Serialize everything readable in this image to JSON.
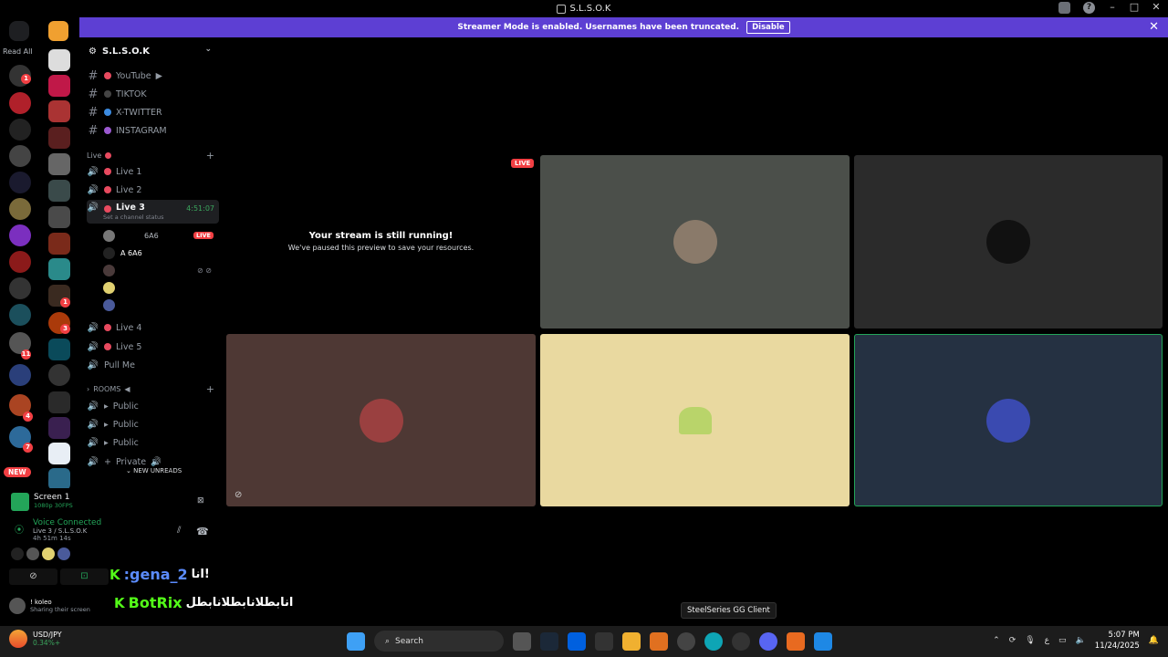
{
  "window": {
    "title": "S.L.S.O.K"
  },
  "banner": {
    "text": "Streamer Mode is enabled. Usernames have been truncated.",
    "disable_label": "Disable"
  },
  "rail": {
    "read_all": "Read All",
    "new_label": "NEW",
    "badges": [
      "1",
      "1",
      "3",
      "11",
      "4",
      "7"
    ]
  },
  "sidebar": {
    "server_name": "S.L.S.O.K",
    "text_channels": [
      {
        "label": "YouTube",
        "suffix": "▶",
        "color": "#e84a5f"
      },
      {
        "label": "TIKTOK",
        "suffix": "",
        "color": "#444"
      },
      {
        "label": "X-TWITTER",
        "suffix": "",
        "color": "#3c8be0"
      },
      {
        "label": "INSTAGRAM",
        "suffix": "",
        "color": "#9b59d0"
      }
    ],
    "live_category": "Live",
    "voice_channels_top": [
      {
        "label": "Live 1"
      },
      {
        "label": "Live 2"
      }
    ],
    "active_channel": {
      "label": "Live 3",
      "time": "4:51:07",
      "status": "Set a channel status"
    },
    "voice_users": [
      {
        "name": "6A6",
        "live": "LIVE"
      },
      {
        "name": "A 6A6",
        "live": ""
      },
      {
        "name": "",
        "live": ""
      },
      {
        "name": "",
        "live": ""
      },
      {
        "name": "",
        "live": ""
      }
    ],
    "voice_channels_bottom": [
      {
        "label": "Live 4"
      },
      {
        "label": "Live 5"
      },
      {
        "label": "Pull Me"
      }
    ],
    "rooms_category": "ROOMS",
    "rooms": [
      {
        "label": "Public"
      },
      {
        "label": "Public"
      },
      {
        "label": "Public"
      },
      {
        "label": "Private"
      }
    ],
    "new_unreads": "NEW UNREADS"
  },
  "panel": {
    "screen_title": "Screen 1",
    "screen_sub": "1080p 30FPS",
    "voice_connected": "Voice Connected",
    "voice_channel": "Live 3 / S.L.S.O.K",
    "voice_time": "4h 51m 14s",
    "user_name": "! koleo",
    "user_status": "Sharing their screen"
  },
  "overlay_chat": [
    {
      "name": ":gena_2",
      "msg": "انا!"
    },
    {
      "name": "BotRix",
      "msg": "انابطلانابطلانابطل"
    },
    {
      "name": "gena_2",
      "msg": ""
    }
  ],
  "stage": {
    "paused_title": "Your stream is still running!",
    "paused_sub": "We've paused this preview to save your resources.",
    "live_badge": "LIVE",
    "tiles": [
      {
        "color": "#4b4f4a"
      },
      {
        "color": "#2b2b2b"
      },
      {
        "color": "#4e3834"
      },
      {
        "color": "#e9d9a0"
      },
      {
        "color": "#253142"
      }
    ]
  },
  "tooltip": "SteelSeries GG Client",
  "taskbar": {
    "ticker_name": "USD/JPY",
    "ticker_value": "0.34%+",
    "search_placeholder": "Search",
    "time": "5:07 PM",
    "date": "11/24/2025"
  }
}
